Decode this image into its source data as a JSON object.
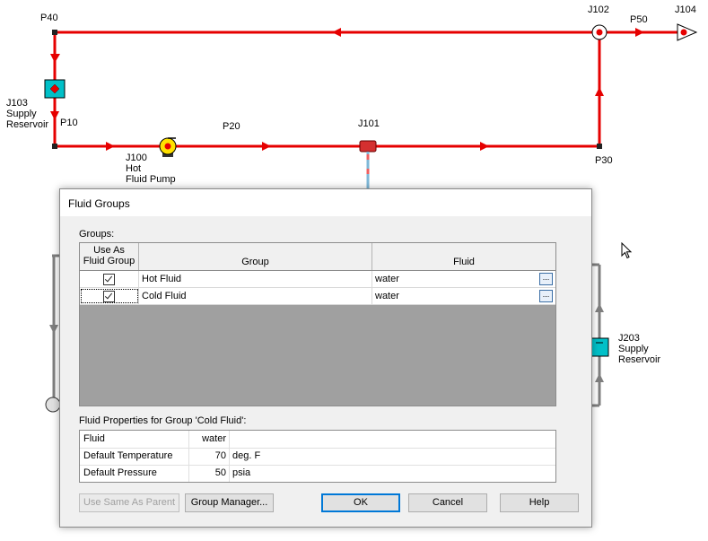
{
  "diagram": {
    "labels": {
      "p40": "P40",
      "j102": "J102",
      "p50": "P50",
      "j104": "J104",
      "j103_id": "J103",
      "j103_l1": "Supply",
      "j103_l2": "Reservoir",
      "p10": "P10",
      "p20": "P20",
      "j101": "J101",
      "j100_id": "J100",
      "j100_l1": "Hot",
      "j100_l2": "Fluid Pump",
      "p30": "P30",
      "j203_id": "J203",
      "j203_l1": "Supply",
      "j203_l2": "Reservoir"
    },
    "colors": {
      "hot_pipe": "#e60000",
      "cold_pipe": "#7f7f7f",
      "reservoir": "#00c0c8",
      "pump": "#ffe000"
    }
  },
  "dialog": {
    "title": "Fluid Groups",
    "groups_caption": "Groups:",
    "columns": {
      "use_as_line1": "Use As",
      "use_as_line2": "Fluid Group",
      "group": "Group",
      "fluid": "Fluid"
    },
    "rows": [
      {
        "checked": true,
        "group": "Hot Fluid",
        "fluid": "water"
      },
      {
        "checked": true,
        "group": "Cold Fluid",
        "fluid": "water"
      }
    ],
    "ellipsis": "...",
    "props_caption": "Fluid Properties for Group 'Cold Fluid':",
    "properties": [
      {
        "name": "Fluid",
        "value": "water",
        "unit": ""
      },
      {
        "name": "Default Temperature",
        "value": "70",
        "unit": "deg. F"
      },
      {
        "name": "Default Pressure",
        "value": "50",
        "unit": "psia"
      }
    ],
    "buttons": {
      "same_as_parent": "Use Same As Parent",
      "group_manager": "Group Manager...",
      "ok": "OK",
      "cancel": "Cancel",
      "help": "Help"
    }
  }
}
